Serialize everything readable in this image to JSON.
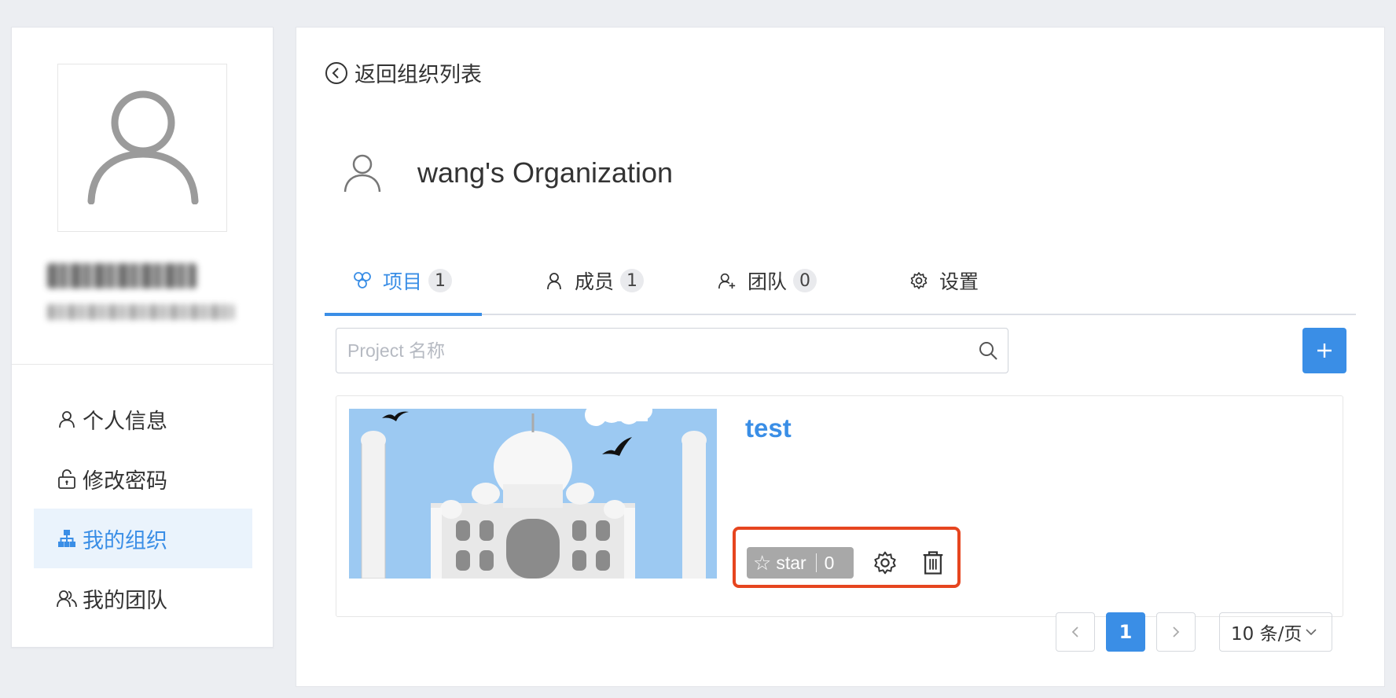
{
  "sidebar": {
    "menu": [
      {
        "label": "个人信息",
        "icon": "user-icon"
      },
      {
        "label": "修改密码",
        "icon": "lock-icon"
      },
      {
        "label": "我的组织",
        "icon": "org-tree-icon",
        "active": true
      },
      {
        "label": "我的团队",
        "icon": "team-icon"
      }
    ]
  },
  "main": {
    "back_label": "返回组织列表",
    "org_title": "wang's Organization",
    "tabs": [
      {
        "label": "项目",
        "count": "1",
        "icon": "project-icon",
        "active": true
      },
      {
        "label": "成员",
        "count": "1",
        "icon": "member-icon"
      },
      {
        "label": "团队",
        "count": "0",
        "icon": "team-add-icon"
      },
      {
        "label": "设置",
        "icon": "gear-icon"
      }
    ],
    "search_placeholder": "Project 名称",
    "add_label": "+",
    "project": {
      "name": "test",
      "star_label": "star",
      "star_count": "0"
    },
    "pagination": {
      "current_page": "1",
      "page_size": "10 条/页"
    }
  },
  "colors": {
    "accent": "#3a8ee6",
    "highlight_border": "#e6451f",
    "active_bg": "#eaf3fc"
  }
}
